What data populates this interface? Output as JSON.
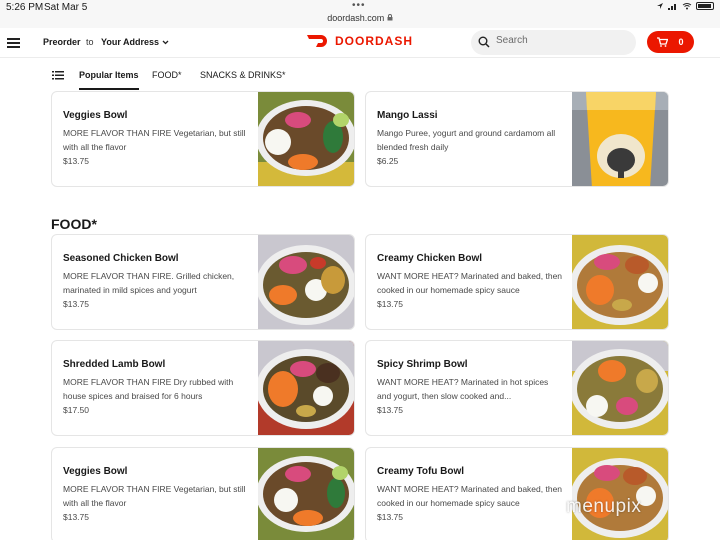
{
  "status_bar": {
    "time": "5:26 PM",
    "date": "Sat Mar 5",
    "url": "doordash.com",
    "dots": "•••",
    "lock_icon": "lock-icon",
    "icons": [
      "location-icon",
      "signal-icon",
      "wifi-icon",
      "battery-icon"
    ]
  },
  "header": {
    "preorder": "Preorder",
    "to": "to",
    "address": "Your Address",
    "logo_text": "DOORDASH",
    "brand_color": "#eb1700",
    "search_placeholder": "Search",
    "cart_count": "0"
  },
  "tabs": {
    "items": [
      {
        "label": "Popular Items",
        "active": true
      },
      {
        "label": "FOOD*",
        "active": false
      },
      {
        "label": "SNACKS & DRINKS*",
        "active": false
      }
    ]
  },
  "popular": [
    {
      "name": "Veggies Bowl",
      "description": "MORE FLAVOR THAN FIRE Vegetarian, but still with all the flavor",
      "price": "$13.75",
      "image": "veggie-bowl-image"
    },
    {
      "name": "Mango Lassi",
      "description": "Mango Puree, yogurt and ground cardamom all blended fresh daily",
      "price": "$6.25",
      "image": "mango-lassi-image"
    }
  ],
  "food_section": {
    "title": "FOOD*",
    "items": [
      {
        "name": "Seasoned Chicken Bowl",
        "description": "MORE FLAVOR THAN FIRE.  Grilled chicken, marinated in mild spices and yogurt",
        "price": "$13.75"
      },
      {
        "name": "Creamy Chicken Bowl",
        "description": "WANT MORE HEAT? Marinated and baked, then cooked in our homemade spicy sauce",
        "price": "$13.75"
      },
      {
        "name": "Shredded Lamb Bowl",
        "description": "MORE FLAVOR THAN FIRE Dry rubbed with house spices and braised for 6 hours",
        "price": "$17.50"
      },
      {
        "name": "Spicy Shrimp Bowl",
        "description": "WANT MORE HEAT? Marinated in hot spices and yogurt, then slow cooked and...",
        "price": "$13.75"
      },
      {
        "name": "Veggies Bowl",
        "description": "MORE FLAVOR THAN FIRE Vegetarian, but still with all the flavor",
        "price": "$13.75"
      },
      {
        "name": "Creamy Tofu Bowl",
        "description": "WANT MORE HEAT? Marinated and baked, then cooked in our homemade spicy sauce",
        "price": "$13.75"
      }
    ]
  },
  "watermark": "menupix"
}
